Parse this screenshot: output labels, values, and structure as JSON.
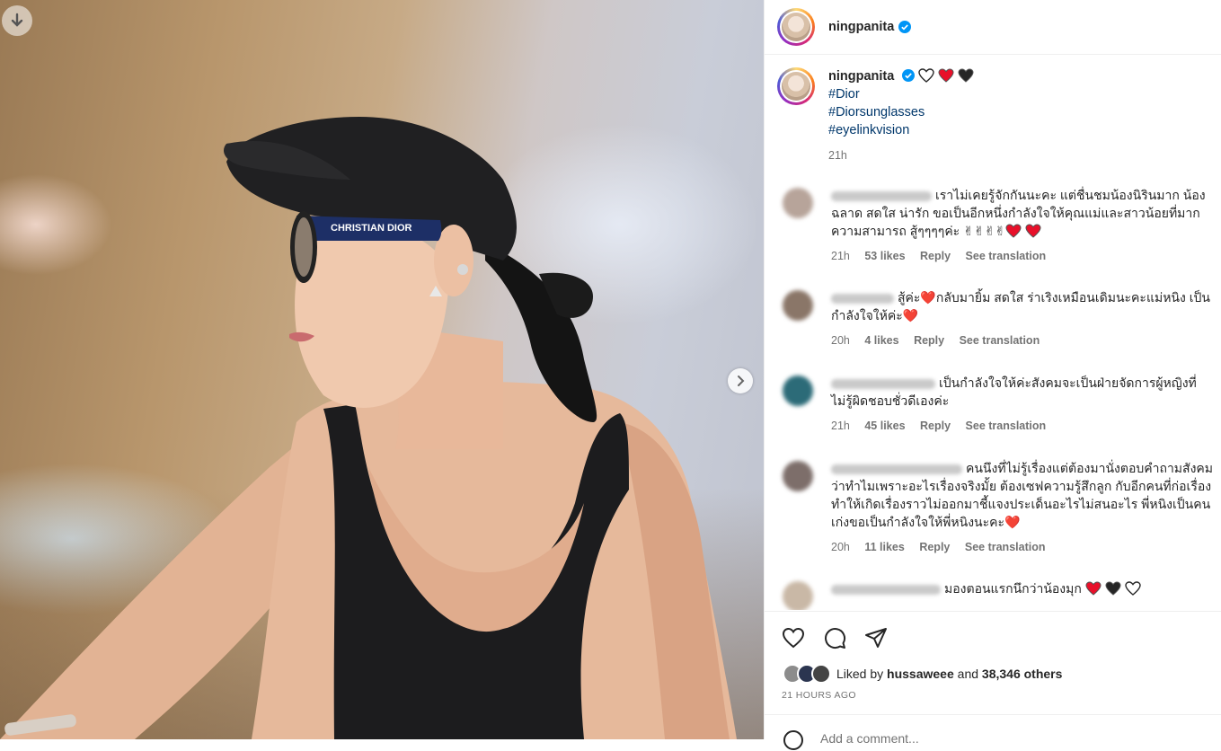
{
  "post": {
    "username": "ningpanita",
    "caption_hearts": [
      "white-heart-icon",
      "red-heart-icon",
      "black-heart-icon"
    ],
    "hashtags": [
      "#Dior",
      "#Diorsunglasses",
      "#eyelinkvision"
    ],
    "time": "21h",
    "sunglasses_text": "CHRISTIAN DIOR"
  },
  "comments": [
    {
      "text": "เราไม่เคยรู้จักกันนะคะ แต่ชื่นชมน้องนิรินมาก น้องฉลาด สดใส น่ารัก ขอเป็นอีกหนึ่งกำลังใจให้คุณแม่และสาวน้อยที่มากความสามารถ สู้ๆๆๆๆค่ะ",
      "emoji": [
        "✌",
        "✌",
        "✌",
        "✌",
        "❤️",
        "❤️"
      ],
      "time": "21h",
      "likes": "53 likes",
      "reply": "Reply",
      "translate": "See translation",
      "avatar_color": "#b7a49a"
    },
    {
      "text": "สู้ค่ะ❤️กลับมายิ้ม สดใส ร่าเริงเหมือนเดิมนะคะแม่หนิง เป็นกำลังใจให้ค่ะ❤️",
      "emoji": [],
      "time": "20h",
      "likes": "4 likes",
      "reply": "Reply",
      "translate": "See translation",
      "avatar_color": "#8a7668"
    },
    {
      "text": "เป็นกำลังใจให้ค่ะสังคมจะเป็นฝ่ายจัดการผู้หญิงที่ไม่รู้ผิดชอบชั่วดีเองค่ะ",
      "emoji": [],
      "time": "21h",
      "likes": "45 likes",
      "reply": "Reply",
      "translate": "See translation",
      "avatar_color": "#2c6b78"
    },
    {
      "text": "คนนึงที่ไม่รู้เรื่องแต่ต้องมานั่งตอบคำถามสังคมว่าทำไมเพราะอะไรเรื่องจริงมั้ย ต้องเซฟความรู้สึกลูก กับอีกคนที่ก่อเรื่องทำให้เกิดเรื่องราวไม่ออกมาชี้แจงประเด็นอะไรไม่สนอะไร พี่หนิงเป็นคนเก่งขอเป็นกำลังใจให้พี่หนิงนะคะ❤️",
      "emoji": [],
      "time": "20h",
      "likes": "11 likes",
      "reply": "Reply",
      "translate": "See translation",
      "avatar_color": "#7d6e6a"
    },
    {
      "text": "มองตอนแรกนึกว่าน้องมุก",
      "emoji": [
        "❤️",
        "🖤",
        "🤍"
      ],
      "avatar_color": "#c9b8a6"
    }
  ],
  "likes": {
    "prefix": "Liked by",
    "user": "hussaweee",
    "joiner": "and",
    "others": "38,346 others"
  },
  "posted_ago": "21 HOURS AGO",
  "add_comment_placeholder": "Add a comment...",
  "colors": {
    "link": "#00376b",
    "verified": "#0095f6",
    "heart_red": "#e8102a"
  }
}
